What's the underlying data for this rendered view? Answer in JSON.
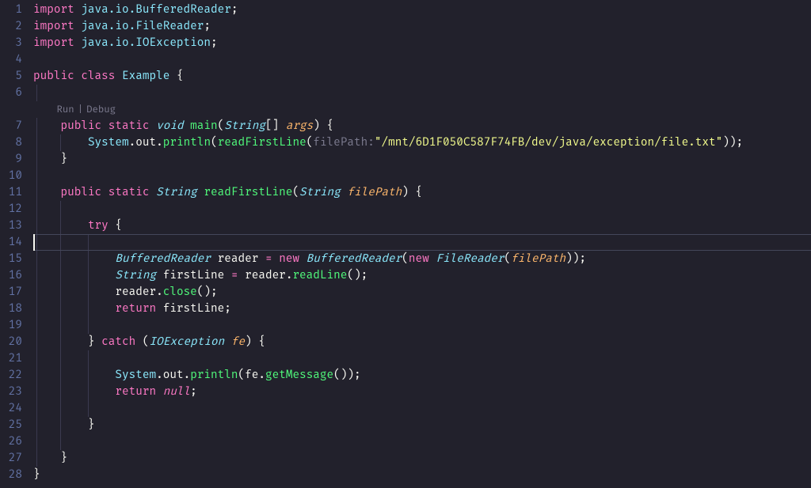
{
  "codelens": {
    "run": "Run",
    "debug": "Debug"
  },
  "filePathHint": "filePath:",
  "filePathString": "\"/mnt/6D1F050C587F74FB/dev/java/exception/file.txt\"",
  "currentLine": 14,
  "lines": {
    "1": [
      {
        "t": "import ",
        "c": "kw"
      },
      {
        "t": "java.io.BufferedReader",
        "c": "cls"
      },
      {
        "t": ";",
        "c": "punc"
      }
    ],
    "2": [
      {
        "t": "import ",
        "c": "kw"
      },
      {
        "t": "java.io.FileReader",
        "c": "cls"
      },
      {
        "t": ";",
        "c": "punc"
      }
    ],
    "3": [
      {
        "t": "import ",
        "c": "kw"
      },
      {
        "t": "java.io.IOException",
        "c": "cls"
      },
      {
        "t": ";",
        "c": "punc"
      }
    ],
    "4": [],
    "5": [
      {
        "t": "public ",
        "c": "kw"
      },
      {
        "t": "class ",
        "c": "kw"
      },
      {
        "t": "Example",
        "c": "cls"
      },
      {
        "t": " {",
        "c": "punc"
      }
    ],
    "6": [],
    "7": [
      {
        "t": "    ",
        "c": ""
      },
      {
        "t": "public ",
        "c": "kw"
      },
      {
        "t": "static ",
        "c": "kw"
      },
      {
        "t": "void ",
        "c": "type"
      },
      {
        "t": "main",
        "c": "fn"
      },
      {
        "t": "(",
        "c": "punc"
      },
      {
        "t": "String",
        "c": "type"
      },
      {
        "t": "[] ",
        "c": "punc"
      },
      {
        "t": "args",
        "c": "param"
      },
      {
        "t": ")",
        "c": "punc"
      },
      {
        "t": " {",
        "c": "punc"
      }
    ],
    "8": [
      {
        "t": "        ",
        "c": ""
      },
      {
        "t": "System",
        "c": "cls"
      },
      {
        "t": ".",
        "c": "punc"
      },
      {
        "t": "out",
        "c": "var"
      },
      {
        "t": ".",
        "c": "punc"
      },
      {
        "t": "println",
        "c": "fn"
      },
      {
        "t": "(",
        "c": "punc"
      },
      {
        "t": "readFirstLine",
        "c": "fn"
      },
      {
        "t": "(",
        "c": "punc"
      },
      {
        "bind": "filePathHint",
        "c": "hint"
      },
      {
        "bind": "filePathString",
        "c": "str"
      },
      {
        "t": "));",
        "c": "punc"
      }
    ],
    "9": [
      {
        "t": "    }",
        "c": "punc"
      }
    ],
    "10": [],
    "11": [
      {
        "t": "    ",
        "c": ""
      },
      {
        "t": "public ",
        "c": "kw"
      },
      {
        "t": "static ",
        "c": "kw"
      },
      {
        "t": "String ",
        "c": "type"
      },
      {
        "t": "readFirstLine",
        "c": "fn"
      },
      {
        "t": "(",
        "c": "punc"
      },
      {
        "t": "String ",
        "c": "type"
      },
      {
        "t": "filePath",
        "c": "param"
      },
      {
        "t": ")",
        "c": "punc"
      },
      {
        "t": " {",
        "c": "punc"
      }
    ],
    "12": [],
    "13": [
      {
        "t": "        ",
        "c": ""
      },
      {
        "t": "try",
        "c": "kw"
      },
      {
        "t": " {",
        "c": "punc"
      }
    ],
    "14": [],
    "15": [
      {
        "t": "            ",
        "c": ""
      },
      {
        "t": "BufferedReader",
        "c": "type"
      },
      {
        "t": " reader ",
        "c": "var"
      },
      {
        "t": "= ",
        "c": "op"
      },
      {
        "t": "new ",
        "c": "kw"
      },
      {
        "t": "BufferedReader",
        "c": "type"
      },
      {
        "t": "(",
        "c": "punc"
      },
      {
        "t": "new ",
        "c": "kw"
      },
      {
        "t": "FileReader",
        "c": "type"
      },
      {
        "t": "(",
        "c": "punc"
      },
      {
        "t": "filePath",
        "c": "param"
      },
      {
        "t": "));",
        "c": "punc"
      }
    ],
    "16": [
      {
        "t": "            ",
        "c": ""
      },
      {
        "t": "String",
        "c": "type"
      },
      {
        "t": " firstLine ",
        "c": "var"
      },
      {
        "t": "= ",
        "c": "op"
      },
      {
        "t": "reader",
        "c": "var"
      },
      {
        "t": ".",
        "c": "punc"
      },
      {
        "t": "readLine",
        "c": "fn"
      },
      {
        "t": "();",
        "c": "punc"
      }
    ],
    "17": [
      {
        "t": "            ",
        "c": ""
      },
      {
        "t": "reader",
        "c": "var"
      },
      {
        "t": ".",
        "c": "punc"
      },
      {
        "t": "close",
        "c": "fn"
      },
      {
        "t": "();",
        "c": "punc"
      }
    ],
    "18": [
      {
        "t": "            ",
        "c": ""
      },
      {
        "t": "return ",
        "c": "kw"
      },
      {
        "t": "firstLine",
        "c": "var"
      },
      {
        "t": ";",
        "c": "punc"
      }
    ],
    "19": [],
    "20": [
      {
        "t": "        } ",
        "c": "punc"
      },
      {
        "t": "catch",
        "c": "kw"
      },
      {
        "t": " (",
        "c": "punc"
      },
      {
        "t": "IOException ",
        "c": "type"
      },
      {
        "t": "fe",
        "c": "param"
      },
      {
        "t": ") {",
        "c": "punc"
      }
    ],
    "21": [],
    "22": [
      {
        "t": "            ",
        "c": ""
      },
      {
        "t": "System",
        "c": "cls"
      },
      {
        "t": ".",
        "c": "punc"
      },
      {
        "t": "out",
        "c": "var"
      },
      {
        "t": ".",
        "c": "punc"
      },
      {
        "t": "println",
        "c": "fn"
      },
      {
        "t": "(",
        "c": "punc"
      },
      {
        "t": "fe",
        "c": "var"
      },
      {
        "t": ".",
        "c": "punc"
      },
      {
        "t": "getMessage",
        "c": "fn"
      },
      {
        "t": "());",
        "c": "punc"
      }
    ],
    "23": [
      {
        "t": "            ",
        "c": ""
      },
      {
        "t": "return ",
        "c": "kw"
      },
      {
        "t": "null",
        "c": "kw2"
      },
      {
        "t": ";",
        "c": "punc"
      }
    ],
    "24": [],
    "25": [
      {
        "t": "        }",
        "c": "punc"
      }
    ],
    "26": [],
    "27": [
      {
        "t": "    }",
        "c": "punc"
      }
    ],
    "28": [
      {
        "t": "}",
        "c": "punc"
      }
    ]
  },
  "guides": {
    "6": [
      1
    ],
    "7": [
      1
    ],
    "8": [
      1,
      2
    ],
    "9": [
      1
    ],
    "10": [
      1
    ],
    "11": [
      1
    ],
    "12": [
      1,
      2
    ],
    "13": [
      1,
      2
    ],
    "14": [
      1,
      2,
      3
    ],
    "15": [
      1,
      2,
      3
    ],
    "16": [
      1,
      2,
      3
    ],
    "17": [
      1,
      2,
      3
    ],
    "18": [
      1,
      2,
      3
    ],
    "19": [
      1,
      2,
      3
    ],
    "20": [
      1,
      2
    ],
    "21": [
      1,
      2,
      3
    ],
    "22": [
      1,
      2,
      3
    ],
    "23": [
      1,
      2,
      3
    ],
    "24": [
      1,
      2,
      3
    ],
    "25": [
      1,
      2
    ],
    "26": [
      1,
      2
    ],
    "27": [
      1
    ]
  },
  "lineNumbers": [
    "1",
    "2",
    "3",
    "4",
    "5",
    "6",
    "7",
    "8",
    "9",
    "10",
    "11",
    "12",
    "13",
    "14",
    "15",
    "16",
    "17",
    "18",
    "19",
    "20",
    "21",
    "22",
    "23",
    "24",
    "25",
    "26",
    "27",
    "28"
  ]
}
